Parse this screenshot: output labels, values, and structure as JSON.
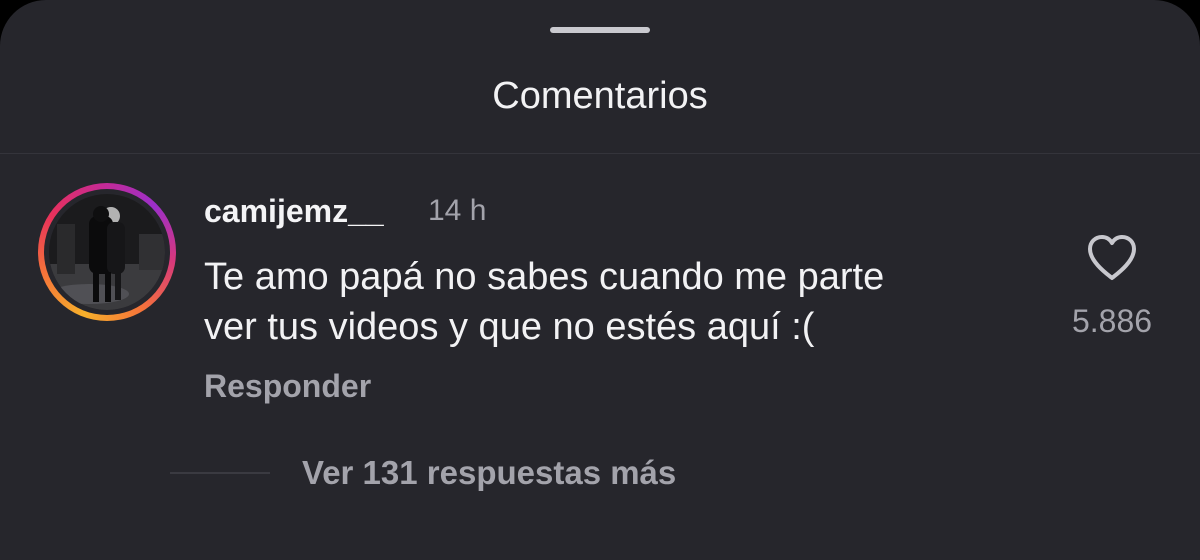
{
  "sheet": {
    "title": "Comentarios"
  },
  "comment": {
    "username": "camijemz__",
    "time": "14 h",
    "text_line1": "Te amo papá no sabes cuando me parte",
    "text_line2": "ver tus videos y que no estés aquí :(",
    "reply_label": "Responder",
    "like_icon": "heart-outline-icon",
    "like_count": "5.886",
    "view_replies_label": "Ver 131 respuestas más"
  },
  "colors": {
    "background": "#26262c",
    "primary_text": "#f2f2f4",
    "secondary_text": "#a3a3ab",
    "story_ring_start": "#f7b02b",
    "story_ring_end": "#c72a93"
  }
}
